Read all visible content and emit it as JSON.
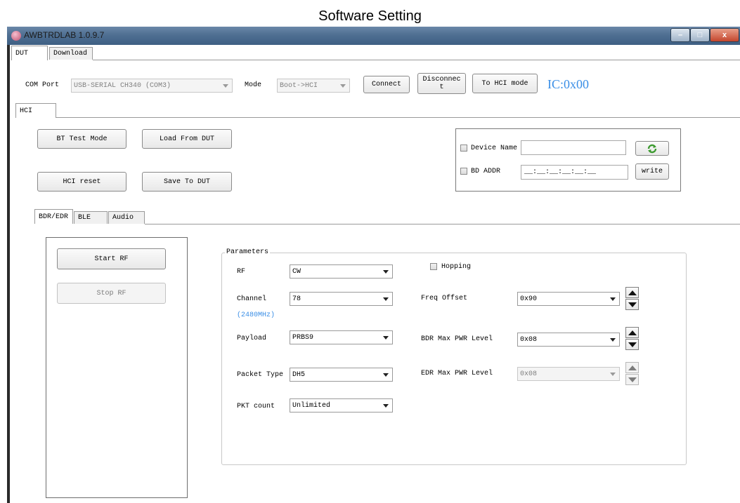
{
  "doc_title": "Software Setting",
  "window": {
    "title": "AWBTRDLAB 1.0.9.7",
    "minimize": "–",
    "maximize": "□",
    "close": "x"
  },
  "main_tabs": [
    "DUT",
    "Download"
  ],
  "top_row": {
    "com_port_label": "COM Port",
    "com_port_value": "USB-SERIAL CH340 (COM3)",
    "mode_label": "Mode",
    "mode_value": "Boot->HCI",
    "connect": "Connect",
    "disconnect_line1": "Disconnec",
    "disconnect_line2": "t",
    "to_hci": "To HCI mode",
    "ic_label": "IC:0x00"
  },
  "hci_tab": "HCI",
  "hci_buttons": {
    "bt_test_mode": "BT Test Mode",
    "load_from_dut": "Load From DUT",
    "hci_reset": "HCI reset",
    "save_to_dut": "Save To DUT"
  },
  "device_box": {
    "device_name_label": "Device Name",
    "device_name_value": "",
    "bd_addr_label": "BD ADDR",
    "bd_addr_value": "__:__:__:__:__:__",
    "write": "write",
    "refresh_icon": "refresh-icon"
  },
  "sub_tabs": [
    "BDR/EDR",
    "BLE",
    "Audio"
  ],
  "rf_buttons": {
    "start": "Start RF",
    "stop": "Stop RF"
  },
  "parameters": {
    "group_title": "Parameters",
    "rf_label": "RF",
    "rf_value": "CW",
    "channel_label": "Channel",
    "channel_value": "78",
    "channel_freq": "(2480MHz)",
    "payload_label": "Payload",
    "payload_value": "PRBS9",
    "packet_type_label": "Packet Type",
    "packet_type_value": "DH5",
    "pkt_count_label": "PKT count",
    "pkt_count_value": "Unlimited",
    "hopping_label": "Hopping",
    "freq_offset_label": "Freq Offset",
    "freq_offset_value": "0x90",
    "bdr_max_label": "BDR Max PWR Level",
    "bdr_max_value": "0x08",
    "edr_max_label": "EDR Max PWR Level",
    "edr_max_value": "0x08"
  },
  "colors": {
    "ic_label": "#3a8ee6",
    "titlebar": "#4f6f92"
  }
}
